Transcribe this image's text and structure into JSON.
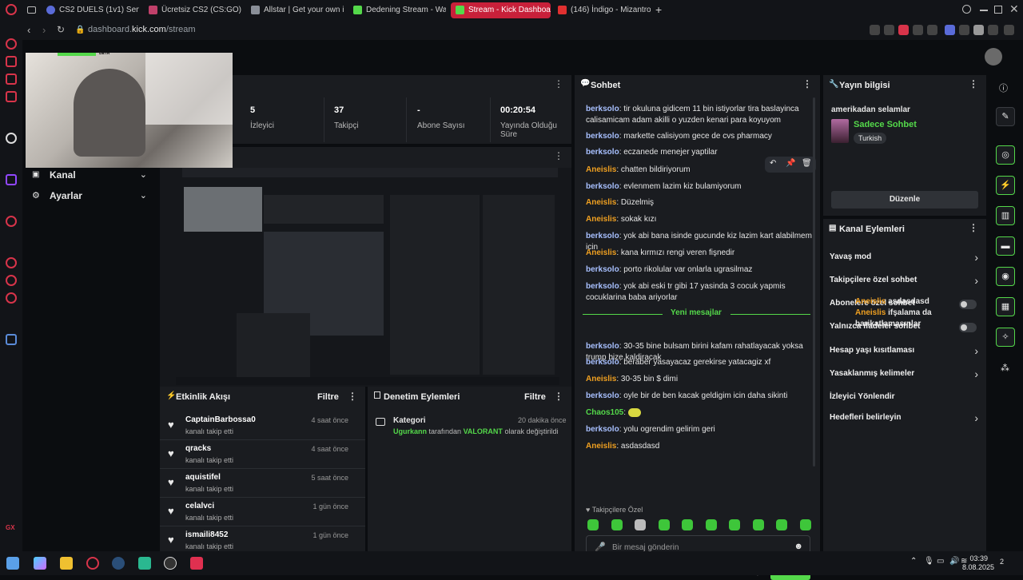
{
  "browser": {
    "tabs": [
      {
        "label": "CS2 DUELS (1v1) Servers",
        "color": "#5a6bd8"
      },
      {
        "label": "Ücretsiz CS2 (CS:GO) ka",
        "color": "#c0406a"
      },
      {
        "label": "Allstar | Get your own in-",
        "color": "#8a8f98"
      },
      {
        "label": "Dedening Stream - Watc",
        "color": "#54d84a"
      },
      {
        "label": "Stream - Kick Dashboard",
        "color": "#54d84a"
      },
      {
        "label": "(146) İndigo - Mizantropi",
        "color": "#e03030"
      }
    ],
    "url_prefix": "dashboard.",
    "url_domain": "kick.com",
    "url_path": "/stream",
    "new_tab": "+"
  },
  "webcam_label": "BETA",
  "left_menu": {
    "title_partial": "eri",
    "section_partial": "esi",
    "items": [
      {
        "label": "Kanal"
      },
      {
        "label": "Ayarlar"
      }
    ]
  },
  "stats": [
    {
      "value": "5",
      "label": "İzleyici"
    },
    {
      "value": "37",
      "label": "Takipçi"
    },
    {
      "value": "-",
      "label": "Abone Sayısı"
    },
    {
      "value": "00:20:54",
      "label": "Yayında Olduğu Süre"
    }
  ],
  "activity": {
    "title": "Etkinlik Akışı",
    "filter": "Filtre",
    "items": [
      {
        "name": "CaptainBarbossa0",
        "sub": "kanalı takip etti",
        "time": "4 saat önce"
      },
      {
        "name": "qracks",
        "sub": "kanalı takip etti",
        "time": "4 saat önce"
      },
      {
        "name": "aquistifel",
        "sub": "kanalı takip etti",
        "time": "5 saat önce"
      },
      {
        "name": "celalvci",
        "sub": "kanalı takip etti",
        "time": "1 gün önce"
      },
      {
        "name": "ismaili8452",
        "sub": "kanalı takip etti",
        "time": "1 gün önce"
      }
    ]
  },
  "moderation": {
    "title": "Denetim Eylemleri",
    "filter": "Filtre",
    "item_title": "Kategori",
    "item_time": "20 dakika önce",
    "item_user": "Ugurkann",
    "item_mid": "tarafından",
    "item_game": "VALORANT",
    "item_end": "olarak değiştirildi"
  },
  "chat": {
    "title": "Sohbet",
    "messages": [
      {
        "user": "berksolo",
        "text": "tir okuluna gidicem 11 bin istiyorlar tira baslayinca calisamicam adam akilli o yuzden kenari para koyuyom",
        "style": "u1"
      },
      {
        "user": "berksolo",
        "text": "markette calisiyom gece de cvs pharmacy",
        "style": "u1"
      },
      {
        "user": "berksolo",
        "text": "eczanede menejer yaptilar",
        "style": "u1"
      },
      {
        "user": "Aneislis",
        "text": "chatten bildiriyorum",
        "style": "u2"
      },
      {
        "user": "berksolo",
        "text": "evlenmem lazim kiz bulamiyorum",
        "style": "u1"
      },
      {
        "user": "Aneislis",
        "text": "Düzelmiş",
        "style": "u2"
      },
      {
        "user": "Aneislis",
        "text": "sokak kızı",
        "style": "u2"
      },
      {
        "user": "berksolo",
        "text": "yok abi bana isinde gucunde kiz lazim kart alabilmem icin",
        "style": "u1"
      },
      {
        "user": "Aneislis",
        "text": "kana kırmızı rengi veren fişnedir",
        "style": "u2"
      },
      {
        "user": "berksolo",
        "text": "porto rikolular var onlarla ugrasilmaz",
        "style": "u1"
      },
      {
        "user": "berksolo",
        "text": "yok abi eski tr gibi 17 yasinda 3 cocuk yapmis cocuklarina baba ariyorlar",
        "style": "u1"
      }
    ],
    "new_messages_label": "Yeni mesajlar",
    "new_messages": [
      {
        "user": "berksolo",
        "text": "30-35 bine bulsam birini kafam rahatlayacak yoksa trump bize kaldiracak",
        "style": "u1"
      },
      {
        "user": "berksolo",
        "text": "beraber yasayacaz gerekirse yatacagiz xf",
        "style": "u1"
      },
      {
        "user": "Aneislis",
        "text": "30-35 bin $ dimi",
        "style": "u2"
      },
      {
        "user": "berksolo",
        "text": "oyle bir de ben kacak geldigim icin daha sikinti",
        "style": "u1"
      },
      {
        "user": "Chaos105",
        "text": "",
        "style": "u3"
      },
      {
        "user": "berksolo",
        "text": "yolu ogrendim gelirim geri",
        "style": "u1"
      },
      {
        "user": "Aneislis",
        "text": "asdasdasd",
        "style": "u2"
      },
      {
        "user": "Aneislis",
        "text": "ifşalama da barikatlamasınlar",
        "style": "u2"
      }
    ],
    "followers_only": "Takipçilere Özel",
    "placeholder": "Bir mesaj gönderin",
    "send": "Gönder"
  },
  "stream_info": {
    "title": "Yayın bilgisi",
    "stream_title": "amerikadan selamlar",
    "category": "Sadece Sohbet",
    "tag": "Turkish",
    "edit": "Düzenle"
  },
  "channel_actions": {
    "title": "Kanal Eylemleri",
    "items": [
      {
        "label": "Yavaş mod",
        "control": "chevron"
      },
      {
        "label": "Takipçilere özel sohbet",
        "control": "chevron"
      },
      {
        "label": "Abonelere özel sohbet",
        "control": "toggle"
      },
      {
        "label": "Yalnızca ifadeler sohbet",
        "control": "toggle"
      },
      {
        "label": "Hesap yaşı kısıtlaması",
        "control": "chevron"
      },
      {
        "label": "Yasaklanmış kelimeler",
        "control": "chevron"
      },
      {
        "label": "İzleyici Yönlendir",
        "control": "none"
      },
      {
        "label": "Hedefleri belirleyin",
        "control": "chevron"
      }
    ],
    "overlay_user": "Aneislis",
    "overlay_msg1": "asdasdasd",
    "overlay_msg2": "ifşalama da barikatlamasınlar"
  },
  "taskbar": {
    "time": "03:39",
    "date": "8.08.2025",
    "notif": "2"
  },
  "colors": {
    "accent": "#54d84a",
    "opera": "#d8344a"
  }
}
